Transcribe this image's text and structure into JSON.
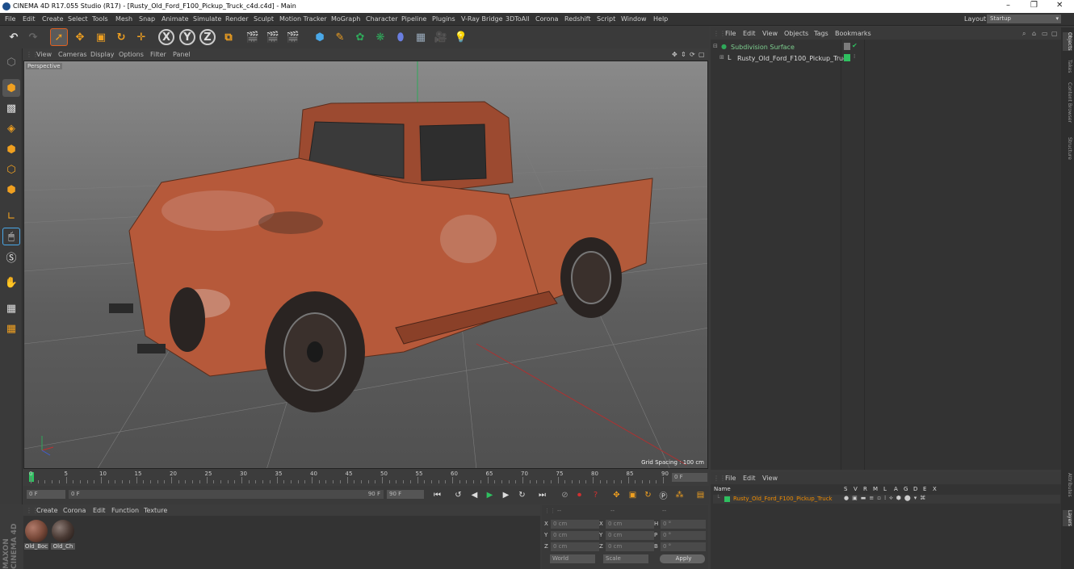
{
  "window": {
    "title": "CINEMA 4D R17.055 Studio (R17) - [Rusty_Old_Ford_F100_Pickup_Truck_c4d.c4d] - Main",
    "minimize": "–",
    "restore": "❐",
    "close": "✕"
  },
  "menu": [
    "File",
    "Edit",
    "Create",
    "Select",
    "Tools",
    "Mesh",
    "Snap",
    "Animate",
    "Simulate",
    "Render",
    "Sculpt",
    "Motion Tracker",
    "MoGraph",
    "Character",
    "Pipeline",
    "Plugins",
    "V-Ray Bridge",
    "3DToAll",
    "Corona",
    "Redshift",
    "Script",
    "Window",
    "Help"
  ],
  "layout": {
    "label": "Layout:",
    "value": "Startup"
  },
  "viewport": {
    "menu": [
      "View",
      "Cameras",
      "Display",
      "Options",
      "Filter",
      "Panel"
    ],
    "label": "Perspective",
    "grid_spacing": "Grid Spacing : 100 cm"
  },
  "timeline": {
    "ticks": [
      "0",
      "5",
      "10",
      "15",
      "20",
      "25",
      "30",
      "35",
      "40",
      "45",
      "50",
      "55",
      "60",
      "65",
      "70",
      "75",
      "80",
      "85",
      "90"
    ],
    "current_frame": "0 F",
    "start": "0 F",
    "slider_start": "0 F",
    "slider_end": "90 F",
    "end": "90 F"
  },
  "materials": {
    "menu": [
      "Create",
      "Corona",
      "Edit",
      "Function",
      "Texture"
    ],
    "items": [
      {
        "label": "Old_Boc",
        "color": "#7a4a3a"
      },
      {
        "label": "Old_Ch",
        "color": "#4a3a34"
      }
    ]
  },
  "coordinates": {
    "header": [
      "--",
      "--",
      "--"
    ],
    "rows": [
      {
        "a": "X",
        "v1": "0 cm",
        "b": "X",
        "v2": "0 cm",
        "c": "H",
        "v3": "0 °"
      },
      {
        "a": "Y",
        "v1": "0 cm",
        "b": "Y",
        "v2": "0 cm",
        "c": "P",
        "v3": "0 °"
      },
      {
        "a": "Z",
        "v1": "0 cm",
        "b": "Z",
        "v2": "0 cm",
        "c": "B",
        "v3": "0 °"
      }
    ],
    "world": "World",
    "scale": "Scale",
    "apply": "Apply"
  },
  "objects": {
    "menu": [
      "File",
      "Edit",
      "View",
      "Objects",
      "Tags",
      "Bookmarks"
    ],
    "items": [
      {
        "name": "Subdivision Surface",
        "indent": 0
      },
      {
        "name": "Rusty_Old_Ford_F100_Pickup_Truck",
        "indent": 1
      }
    ]
  },
  "layers": {
    "menu": [
      "File",
      "Edit",
      "View"
    ],
    "columns": [
      "Name",
      "S",
      "V",
      "R",
      "M",
      "L",
      "A",
      "G",
      "D",
      "E",
      "X"
    ],
    "row": "Rusty_Old_Ford_F100_Pickup_Truck"
  },
  "right_tabs": [
    "Objects",
    "Takes",
    "Content Browser",
    "Structure",
    "Attributes",
    "Layers"
  ],
  "brand": [
    "MAXON",
    "CINEMA 4D"
  ],
  "colors": {
    "accent": "#f0a020",
    "selected": "#f08c00",
    "green": "#2fa85a"
  }
}
